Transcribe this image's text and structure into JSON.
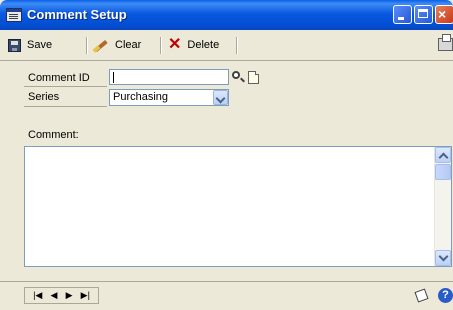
{
  "window": {
    "title": "Comment Setup"
  },
  "toolbar": {
    "save": "Save",
    "clear": "Clear",
    "delete": "Delete"
  },
  "form": {
    "comment_id_label": "Comment ID",
    "comment_id_value": "",
    "series_label": "Series",
    "series_value": "Purchasing",
    "comment_label": "Comment:"
  },
  "icons": [
    "app-icon",
    "save-icon",
    "clear-icon",
    "delete-icon",
    "print-icon",
    "lookup-icon",
    "new-document-icon",
    "chevron-down-icon",
    "note-icon",
    "help-icon"
  ],
  "colors": {
    "title_bar": "#0350d6",
    "window_bg": "#ece9d8",
    "delete_red": "#c00000"
  }
}
